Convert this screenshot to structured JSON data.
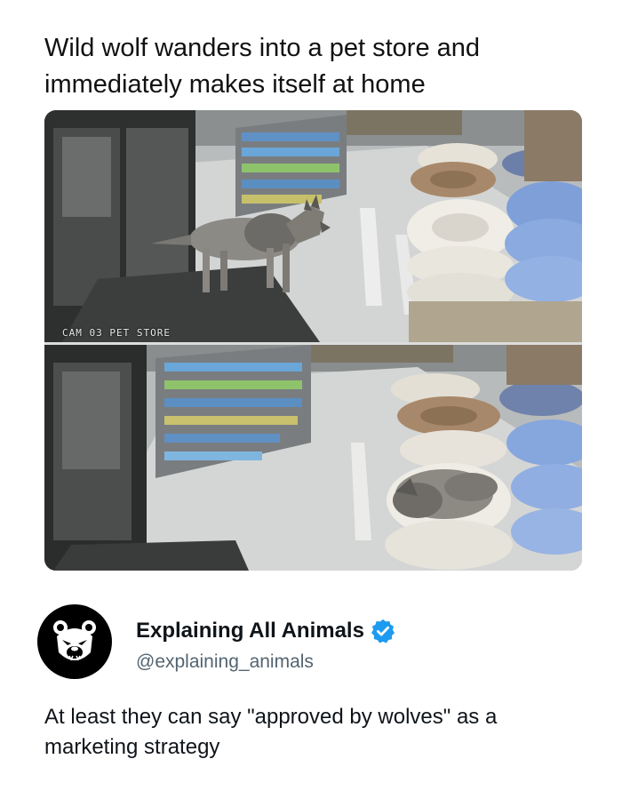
{
  "headline": "Wild wolf wanders into a pet store and immediately makes itself at home",
  "photo": {
    "top_panel_alt": "Wolf walking through the pet store entrance",
    "bottom_panel_alt": "Wolf curled up asleep in a pet bed",
    "cam_label": "CAM 03  PET STORE"
  },
  "tweet": {
    "display_name": "Explaining All Animals",
    "handle": "@explaining_animals",
    "text": "At least they can say \"approved by wolves\" as a marketing strategy",
    "verified": true,
    "verified_color": "#1d9bf0"
  }
}
